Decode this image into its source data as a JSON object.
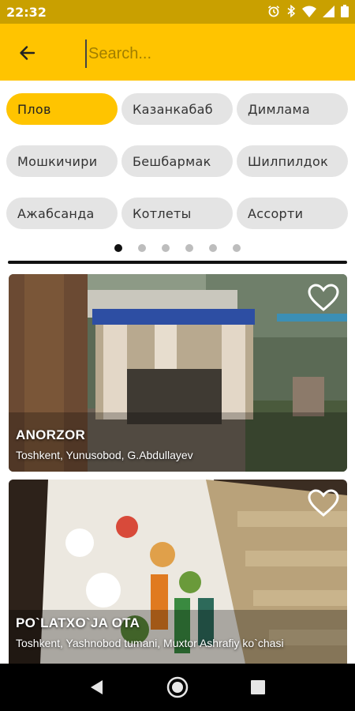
{
  "status_bar": {
    "time": "22:32",
    "icons": [
      "alarm-icon",
      "bluetooth-icon",
      "wifi-icon",
      "signal-icon",
      "battery-icon"
    ]
  },
  "app_bar": {
    "back_icon": "arrow-left-icon",
    "search_placeholder": "Search...",
    "search_value": ""
  },
  "categories": [
    {
      "label": "Плов",
      "active": true
    },
    {
      "label": "Казанкабаб",
      "active": false
    },
    {
      "label": "Димлама",
      "active": false
    },
    {
      "label": "Мошкичири",
      "active": false
    },
    {
      "label": "Бешбармак",
      "active": false
    },
    {
      "label": "Шилпилдок",
      "active": false
    },
    {
      "label": "Ажабсанда",
      "active": false
    },
    {
      "label": "Котлеты",
      "active": false
    },
    {
      "label": "Ассорти",
      "active": false
    }
  ],
  "pager": {
    "pages": 6,
    "current": 1
  },
  "restaurants": [
    {
      "name": "ANORZOR",
      "address": "Toshkent, Yunusobod, G.Abdullayev",
      "favorite": false
    },
    {
      "name": "PO`LATXO`JA OTA",
      "address": "Toshkent, Yashnobod tumani, Muxtor Ashrafiy ko`chasi",
      "favorite": false
    }
  ],
  "nav": {
    "items": [
      "back-triangle-icon",
      "home-circle-icon",
      "recents-square-icon"
    ]
  },
  "colors": {
    "accent": "#ffc400",
    "status_bar": "#c9a000",
    "chip": "#e4e4e4"
  }
}
